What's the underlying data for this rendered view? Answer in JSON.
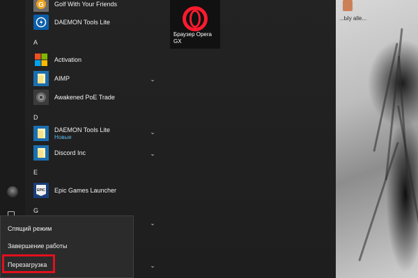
{
  "start_menu": {
    "apps": [
      {
        "label": "Golf With Your Friends",
        "icon": "golf-app-icon"
      },
      {
        "label": "DAEMON Tools Lite",
        "icon": "daemon-tools-icon"
      },
      {
        "label": "Activation",
        "icon": "windows-logo-icon"
      },
      {
        "label": "AIMP",
        "icon": "folder-icon"
      },
      {
        "label": "Awakened PoE Trade",
        "icon": "poe-trade-icon"
      },
      {
        "label": "DAEMON Tools Lite",
        "sublabel": "Новые",
        "icon": "folder-icon"
      },
      {
        "label": "Discord Inc",
        "icon": "folder-icon"
      },
      {
        "label": "Epic Games Launcher",
        "icon": "epic-games-icon",
        "icon_text": "EPIC"
      }
    ],
    "section_letters": [
      "A",
      "D",
      "E",
      "G"
    ],
    "pinned_tile": {
      "label": "Браузер Opera GX",
      "icon": "opera-gx-icon"
    }
  },
  "power_menu": {
    "sleep_label": "Спящий режим",
    "shutdown_label": "Завершение работы",
    "restart_label": "Перезагрузка",
    "highlight_color": "#e3101d"
  },
  "desktop": {
    "icon_label": "...Ыу alle..."
  },
  "colors": {
    "menu_bg": "#232323",
    "accent_blue": "#0a5ea8",
    "new_badge": "#5bb7e8",
    "opera_red": "#ff1b2d"
  }
}
